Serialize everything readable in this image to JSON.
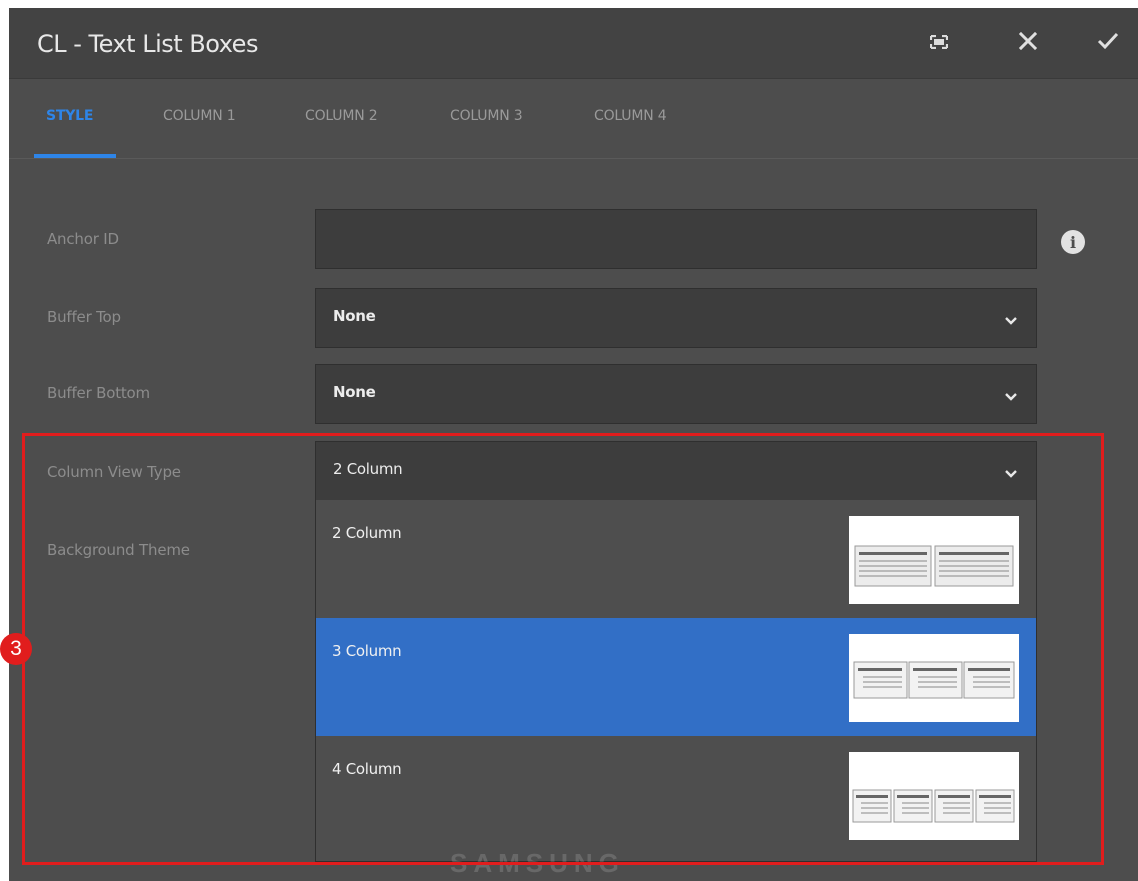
{
  "dialog": {
    "title": "CL - Text List Boxes",
    "toolbar": {
      "fullscreen_icon": "fullscreen-icon",
      "close_icon": "close-icon",
      "done_icon": "check-icon"
    }
  },
  "tabs": [
    {
      "label": "STYLE",
      "active": true
    },
    {
      "label": "COLUMN 1",
      "active": false
    },
    {
      "label": "COLUMN 2",
      "active": false
    },
    {
      "label": "COLUMN 3",
      "active": false
    },
    {
      "label": "COLUMN 4",
      "active": false
    }
  ],
  "form": {
    "anchor_id": {
      "label": "Anchor ID",
      "value": "",
      "info_icon": "info-icon"
    },
    "buffer_top": {
      "label": "Buffer Top",
      "value": "None"
    },
    "buffer_bottom": {
      "label": "Buffer Bottom",
      "value": "None"
    },
    "column_view_type": {
      "label": "Column View Type",
      "value": "2 Column"
    },
    "background_theme": {
      "label": "Background Theme"
    }
  },
  "dropdown": {
    "options": [
      {
        "label": "2 Column",
        "columns": 2,
        "selected": false
      },
      {
        "label": "3 Column",
        "columns": 3,
        "selected": true
      },
      {
        "label": "4 Column",
        "columns": 4,
        "selected": false
      }
    ]
  },
  "annotation": {
    "step_number": "3",
    "color": "#e11d1d"
  },
  "watermark": {
    "text": "SAMSUNG"
  },
  "colors": {
    "accent": "#2e85e8",
    "selected_option": "#326fc6",
    "panel": "#4d4d4d",
    "titlebar": "#434343"
  }
}
